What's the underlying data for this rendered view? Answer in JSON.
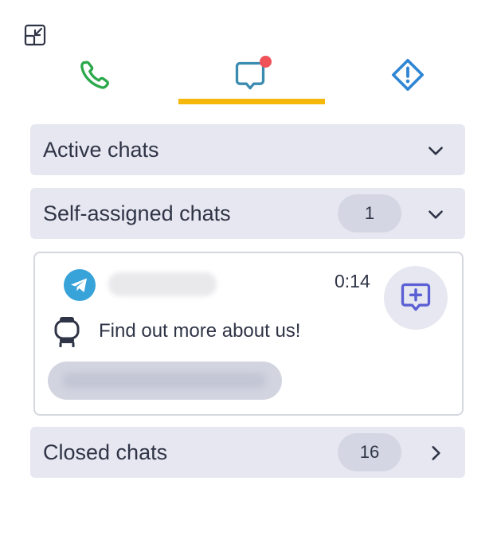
{
  "toolbar": {
    "minimize_icon": "minimize-icon"
  },
  "tabs": [
    {
      "name": "calls",
      "icon": "phone-icon",
      "color": "#2aa84a"
    },
    {
      "name": "chats",
      "icon": "chat-bubble-icon",
      "color": "#3b8bb0",
      "active": true,
      "has_notification": true,
      "notification_color": "#f0525a"
    },
    {
      "name": "alerts",
      "icon": "alert-diamond-icon",
      "color": "#2f86d4"
    }
  ],
  "accent_color": "#f5b70a",
  "sections": {
    "active": {
      "title": "Active chats"
    },
    "self_assigned": {
      "title": "Self-assigned chats",
      "count": "1"
    },
    "closed": {
      "title": "Closed chats",
      "count": "16"
    }
  },
  "chat": {
    "channel_icon": "telegram-icon",
    "time": "0:14",
    "message": "Find out more about us!",
    "sender_icon": "bot-icon",
    "action_icon": "new-message-icon"
  }
}
